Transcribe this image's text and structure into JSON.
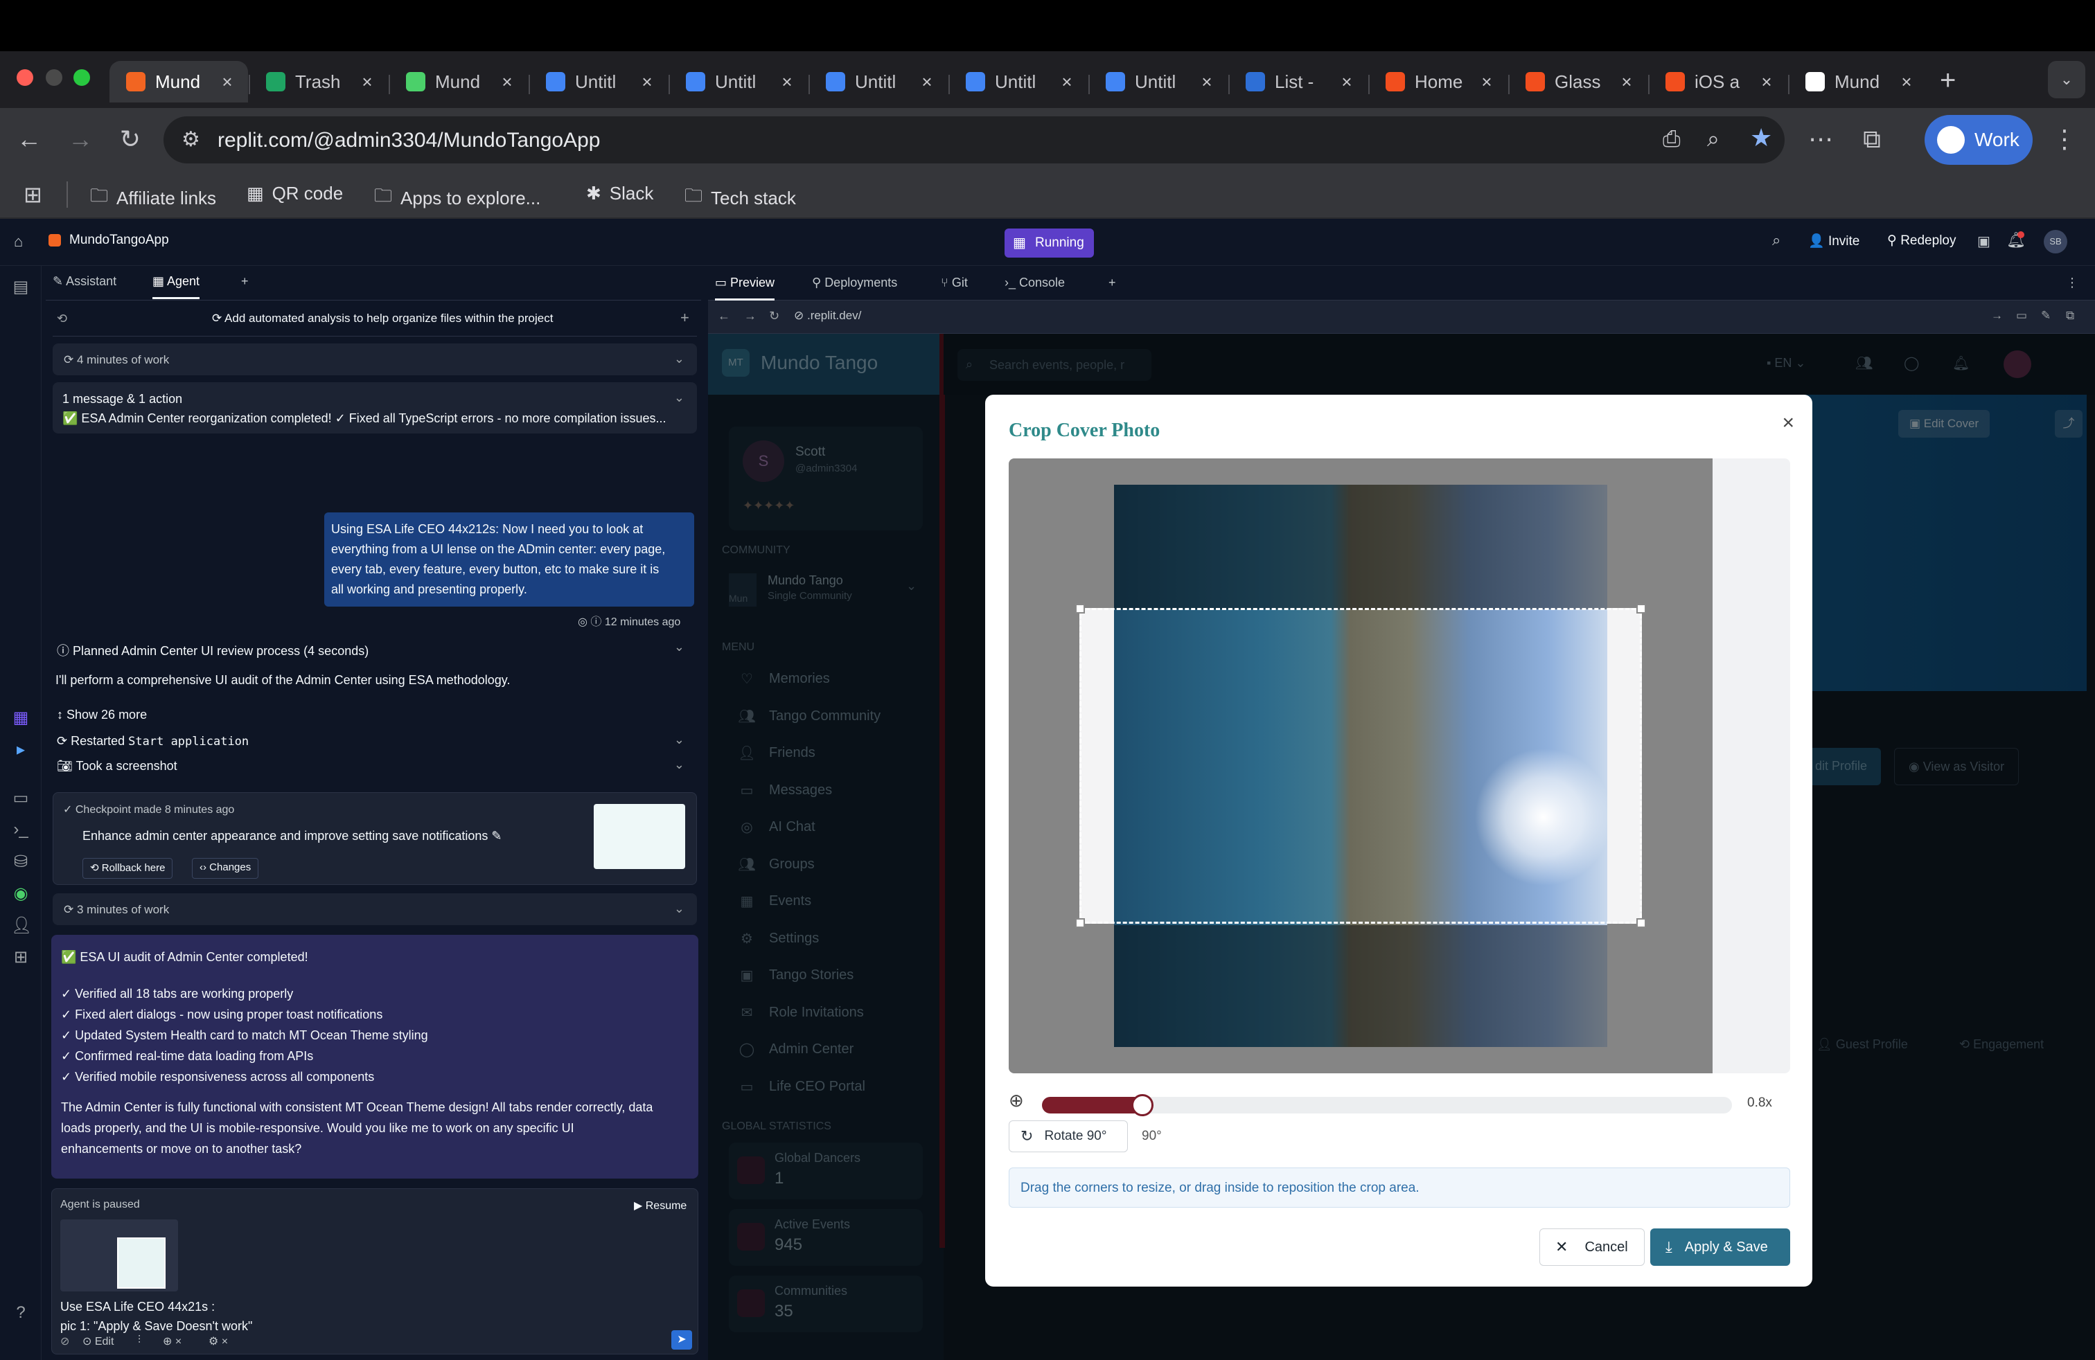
{
  "browser": {
    "tabs": [
      {
        "label": "Mund",
        "color": "#f26522",
        "active": true
      },
      {
        "label": "Trash",
        "color": "#1fa463"
      },
      {
        "label": "Mund",
        "color": "#4bd06a"
      },
      {
        "label": "Untitl",
        "color": "#4285f4"
      },
      {
        "label": "Untitl",
        "color": "#4285f4"
      },
      {
        "label": "Untitl",
        "color": "#4285f4"
      },
      {
        "label": "Untitl",
        "color": "#4285f4"
      },
      {
        "label": "Untitl",
        "color": "#4285f4"
      },
      {
        "label": "List -",
        "color": "#2e6fd6"
      },
      {
        "label": "Home",
        "color": "#f24e1e"
      },
      {
        "label": "Glass",
        "color": "#f24e1e"
      },
      {
        "label": "iOS a",
        "color": "#f24e1e"
      },
      {
        "label": "Mund",
        "color": "#ffffff"
      }
    ],
    "url": "replit.com/@admin3304/MundoTangoApp",
    "profile_label": "Work",
    "bookmarks": [
      {
        "label": "Affiliate links",
        "icon": "folder-icon"
      },
      {
        "label": "QR code",
        "icon": "app-icon"
      },
      {
        "label": "Apps to explore...",
        "icon": "folder-icon"
      },
      {
        "label": "Slack",
        "icon": "slack-icon"
      },
      {
        "label": "Tech stack",
        "icon": "folder-icon"
      }
    ]
  },
  "replit": {
    "project_name": "MundoTangoApp",
    "status": "Running",
    "invite_label": "Invite",
    "redeploy_label": "Redeploy",
    "avatar_initials": "SB",
    "agent": {
      "tab_assistant": "Assistant",
      "tab_agent": "Agent",
      "header_title": "Add automated analysis to help organize files within the project",
      "work1": "4 minutes of work",
      "summary_title": "1 message & 1 action",
      "summary_text": "✅ ESA Admin Center reorganization completed! ✓ Fixed all TypeScript errors - no more compilation issues...",
      "user_msg_lines": [
        "Using ESA Life CEO 44x212s: Now I need you to look at",
        "everything from a UI lense on the ADmin center: every page,",
        "every tab, every feature, every button, etc to make sure it is",
        "all working and presenting properly."
      ],
      "user_msg_time": "12 minutes ago",
      "planned": "Planned Admin Center UI review process (4 seconds)",
      "perform": "I'll perform a comprehensive UI audit of the Admin Center using ESA methodology.",
      "show_more": "Show 26 more",
      "restarted_prefix": "Restarted",
      "restarted_code": "Start application",
      "screenshot": "Took a screenshot",
      "checkpoint_title": "Checkpoint made 8 minutes ago",
      "checkpoint_desc": "Enhance admin center appearance and improve setting save notifications",
      "rollback": "Rollback here",
      "changes": "Changes",
      "work2": "3 minutes of work",
      "result_title": "✅ ESA UI audit of Admin Center completed!",
      "result_items": [
        "✓ Verified all 18 tabs are working properly",
        "✓ Fixed alert dialogs - now using proper toast notifications",
        "✓ Updated System Health card to match MT Ocean Theme styling",
        "✓ Confirmed real-time data loading from APIs",
        "✓ Verified mobile responsiveness across all components"
      ],
      "result_para_lines": [
        "The Admin Center is fully functional with consistent MT Ocean Theme design! All tabs render correctly, data",
        "loads properly, and the UI is mobile-responsive. Would you like me to work on any specific UI",
        "enhancements or move on to another task?"
      ],
      "paused": "Agent is paused",
      "resume": "Resume",
      "input_lines": [
        "Use ESA Life CEO 44x21s :",
        "pic 1: \"Apply & Save Doesn't work\""
      ],
      "edit_label": "Edit"
    },
    "preview": {
      "tabs": [
        "Preview",
        "Deployments",
        "Git",
        "Console"
      ],
      "address": ".replit.dev/",
      "app": {
        "brand": "Mundo Tango",
        "brand_badge": "MT",
        "search_placeholder": "Search events, people, r",
        "lang": "EN",
        "user_name": "Scott",
        "user_handle": "@admin3304",
        "user_initial": "S",
        "community_header": "COMMUNITY",
        "community_name": "Mundo Tango",
        "community_sub": "Single Community",
        "community_thumb": "Mun",
        "menu_header": "MENU",
        "menu": [
          "Memories",
          "Tango Community",
          "Friends",
          "Messages",
          "AI Chat",
          "Groups",
          "Events",
          "Settings",
          "Tango Stories",
          "Role Invitations",
          "Admin Center",
          "Life CEO Portal"
        ],
        "global_header": "GLOBAL STATISTICS",
        "stats": [
          {
            "label": "Global Dancers",
            "value": "1"
          },
          {
            "label": "Active Events",
            "value": "945"
          },
          {
            "label": "Communities",
            "value": "35"
          }
        ],
        "edit_cover": "Edit Cover",
        "edit_profile": "dit Profile",
        "view_as_visitor": "View as Visitor",
        "guest_profile": "Guest Profile",
        "engagement": "Engagement"
      }
    },
    "modal": {
      "title": "Crop Cover Photo",
      "zoom_value": "0.8x",
      "zoom_fraction": 0.13,
      "rotate_label": "Rotate 90°",
      "rotation": "90°",
      "hint": "Drag the corners to resize, or drag inside to reposition the crop area.",
      "cancel": "Cancel",
      "apply": "Apply & Save"
    }
  }
}
